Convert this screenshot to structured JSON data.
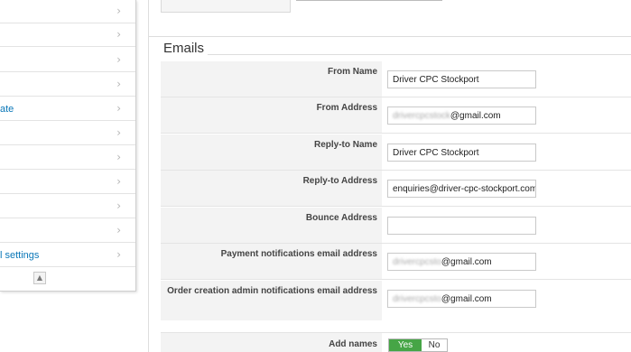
{
  "sidebar": {
    "items": [
      {
        "label": ""
      },
      {
        "label": ""
      },
      {
        "label": ""
      },
      {
        "label": ""
      },
      {
        "label": "ate"
      },
      {
        "label": ""
      },
      {
        "label": ""
      },
      {
        "label": ""
      },
      {
        "label": ""
      },
      {
        "label": ""
      },
      {
        "label": "l settings"
      }
    ],
    "chevron": "›",
    "collapse_glyph": "▲"
  },
  "emails": {
    "legend": "Emails",
    "fields": [
      {
        "label": "From Name",
        "value": "Driver CPC Stockport"
      },
      {
        "label": "From Address",
        "value_hidden": "drivercpcstock",
        "value_suffix": "@gmail.com"
      },
      {
        "label": "Reply-to Name",
        "value": "Driver CPC Stockport"
      },
      {
        "label": "Reply-to Address",
        "value": "enquiries@driver-cpc-stockport.com"
      },
      {
        "label": "Bounce Address",
        "value": ""
      },
      {
        "label": "Payment notifications email address",
        "value_hidden": "drivercpcsto",
        "value_suffix": "@gmail.com"
      },
      {
        "label": "Order creation admin notifications email address",
        "value_hidden": "drivercpcsto",
        "value_suffix": "@gmail.com"
      }
    ],
    "add_names": {
      "label": "Add names",
      "yes": "Yes",
      "no": "No",
      "selected": "Yes",
      "accent": "#46a546"
    }
  }
}
